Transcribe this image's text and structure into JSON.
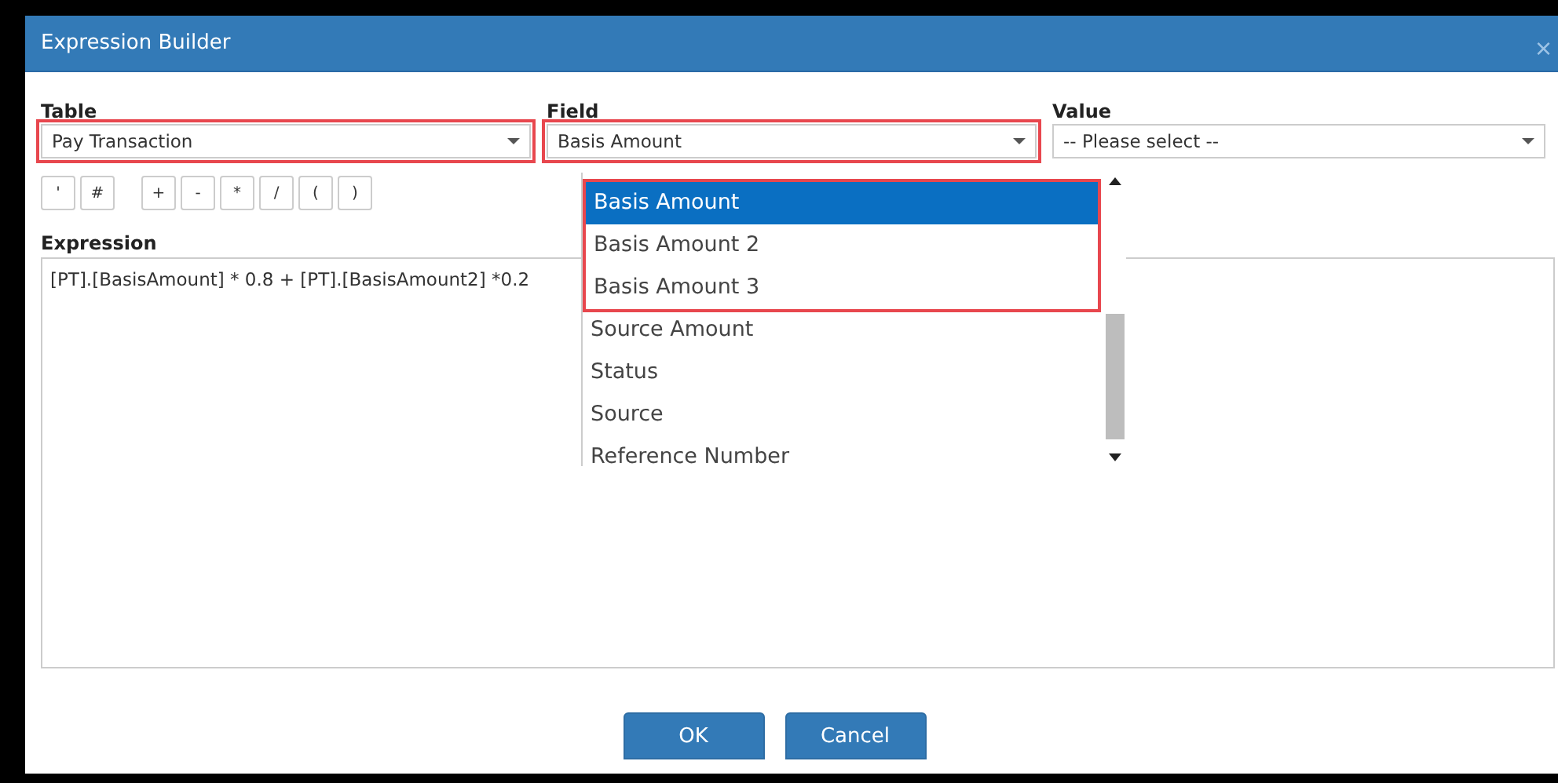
{
  "window": {
    "title": "Expression Builder",
    "close": "×"
  },
  "fields": [
    {
      "label": "Table",
      "value": "Pay Transaction",
      "highlighted": true
    },
    {
      "label": "Field",
      "value": "Basis Amount",
      "highlighted": true
    },
    {
      "label": "Value",
      "placeholder": "-- Please select --",
      "highlighted": false
    }
  ],
  "operator_groups": [
    [
      "'",
      "#"
    ],
    [
      "+",
      "-",
      "*",
      "/",
      "(",
      ")"
    ]
  ],
  "expression": {
    "label": "Expression",
    "value": "[PT].[BasisAmount] * 0.8 + [PT].[BasisAmount2] *0.2"
  },
  "field_dropdown": {
    "items": [
      {
        "label": "Basis Amount",
        "selected": true,
        "highlighted": true
      },
      {
        "label": "Basis Amount 2",
        "selected": false,
        "highlighted": true
      },
      {
        "label": "Basis Amount 3",
        "selected": false,
        "highlighted": true
      },
      {
        "label": "Source Amount",
        "selected": false,
        "highlighted": false
      },
      {
        "label": "Status",
        "selected": false,
        "highlighted": false
      },
      {
        "label": "Source",
        "selected": false,
        "highlighted": false
      },
      {
        "label": "Reference Number",
        "selected": false,
        "highlighted": false
      }
    ]
  },
  "buttons": [
    "OK",
    "Cancel"
  ]
}
